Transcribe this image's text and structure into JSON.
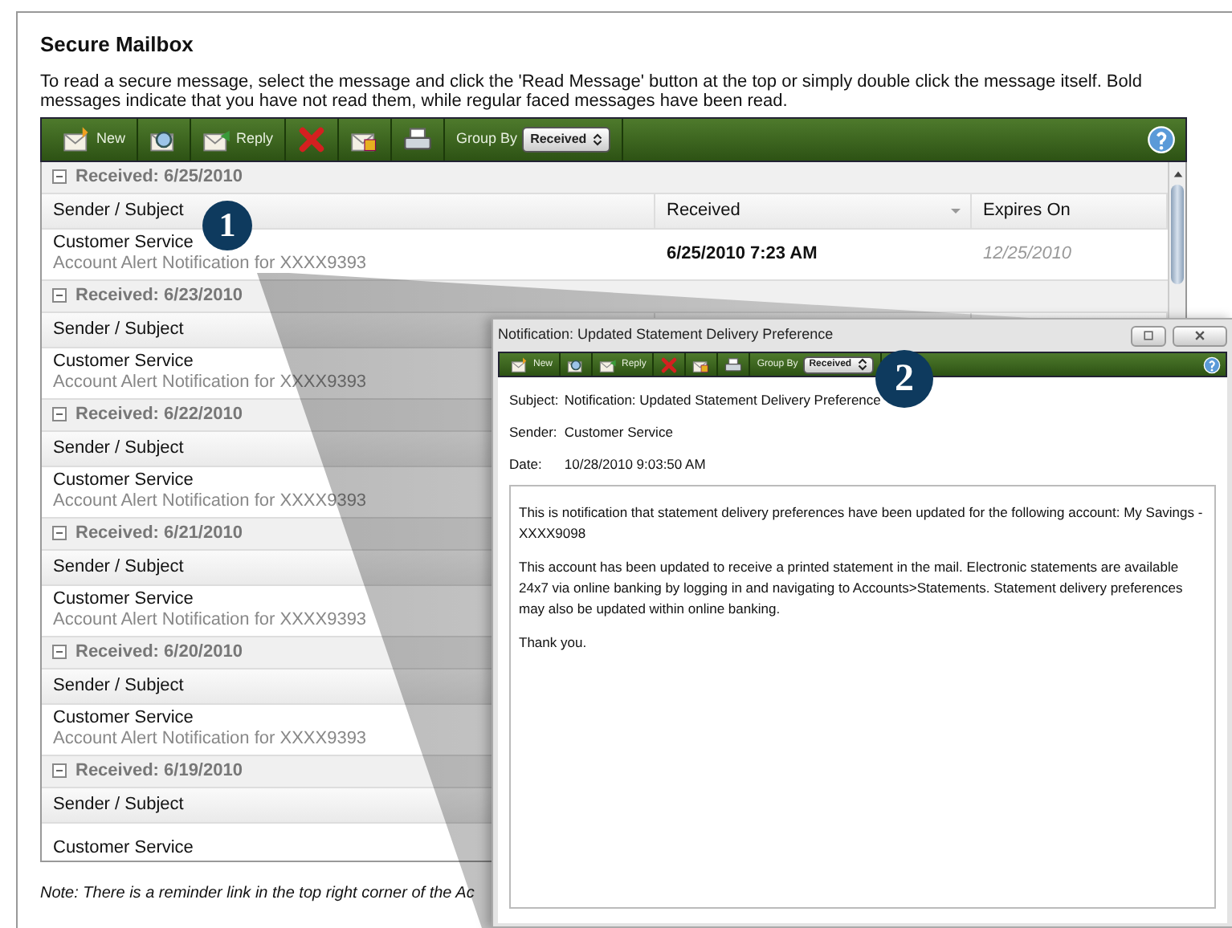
{
  "page": {
    "title": "Secure Mailbox",
    "intro": "To read a secure message, select the message and click the 'Read Message' button at the top or simply double click the message itself. Bold messages indicate that you have not read them, while regular faced messages have been read.",
    "note": "Note: There is a reminder link in the top right corner of the Ac"
  },
  "toolbar": [
    {
      "kind": "new",
      "label": "New"
    },
    {
      "kind": "open"
    },
    {
      "kind": "reply",
      "label": "Reply"
    },
    {
      "kind": "delete"
    },
    {
      "kind": "lock"
    },
    {
      "kind": "print"
    },
    {
      "kind": "group_by",
      "label": "Group By",
      "value": "Received"
    },
    {
      "kind": "help"
    }
  ],
  "groups": [
    {
      "label": "Received: 6/25/2010",
      "expanded": true,
      "columns": [
        "Sender / Subject",
        "Received",
        "Expires On"
      ],
      "messages": [
        {
          "sender": "Customer Service",
          "subject": "Account Alert Notification for XXXX9393",
          "received": "6/25/2010 7:23 AM",
          "expires": "12/25/2010"
        }
      ]
    },
    {
      "label": "Received: 6/23/2010",
      "expanded": true,
      "columns": [
        "Sender / Subject"
      ],
      "messages": [
        {
          "sender": "Customer Service",
          "subject": "Account Alert Notification for XXXX9393"
        }
      ]
    },
    {
      "label": "Received: 6/22/2010",
      "expanded": true,
      "columns": [
        "Sender / Subject"
      ],
      "messages": [
        {
          "sender": "Customer Service",
          "subject": "Account Alert Notification for XXXX9393"
        }
      ]
    },
    {
      "label": "Received: 6/21/2010",
      "expanded": true,
      "columns": [
        "Sender / Subject"
      ],
      "messages": [
        {
          "sender": "Customer Service",
          "subject": "Account Alert Notification for XXXX9393"
        }
      ]
    },
    {
      "label": "Received: 6/20/2010",
      "expanded": true,
      "columns": [
        "Sender / Subject"
      ],
      "messages": [
        {
          "sender": "Customer Service",
          "subject": "Account Alert Notification for XXXX9393"
        }
      ]
    },
    {
      "label": "Received: 6/19/2010",
      "expanded": true,
      "columns": [
        "Sender / Subject"
      ],
      "messages": [
        {
          "sender": "Customer Service"
        }
      ]
    }
  ],
  "popup": {
    "title": "Notification: Updated Statement Delivery Preference",
    "toolbar": [
      {
        "kind": "new",
        "label": "New"
      },
      {
        "kind": "open"
      },
      {
        "kind": "reply",
        "label": "Reply"
      },
      {
        "kind": "delete"
      },
      {
        "kind": "lock"
      },
      {
        "kind": "print"
      },
      {
        "kind": "group_by",
        "label": "Group By",
        "value": "Received"
      },
      {
        "kind": "help"
      }
    ],
    "fields": [
      {
        "label": "Subject:",
        "value": "Notification: Updated Statement Delivery Preference"
      },
      {
        "label": "Sender:",
        "value": "Customer Service"
      },
      {
        "label": "Date:",
        "value": "10/28/2010 9:03:50 AM"
      }
    ],
    "body": [
      "This is notification that statement delivery preferences have been updated for the following account: My Savings - XXXX9098",
      "This account has been updated to receive a printed statement in the mail.  Electronic statements are available 24x7 via online banking by logging in and navigating to Accounts>Statements.  Statement delivery preferences may also be updated within online banking.",
      "Thank you."
    ]
  },
  "callouts": [
    "1",
    "2"
  ]
}
